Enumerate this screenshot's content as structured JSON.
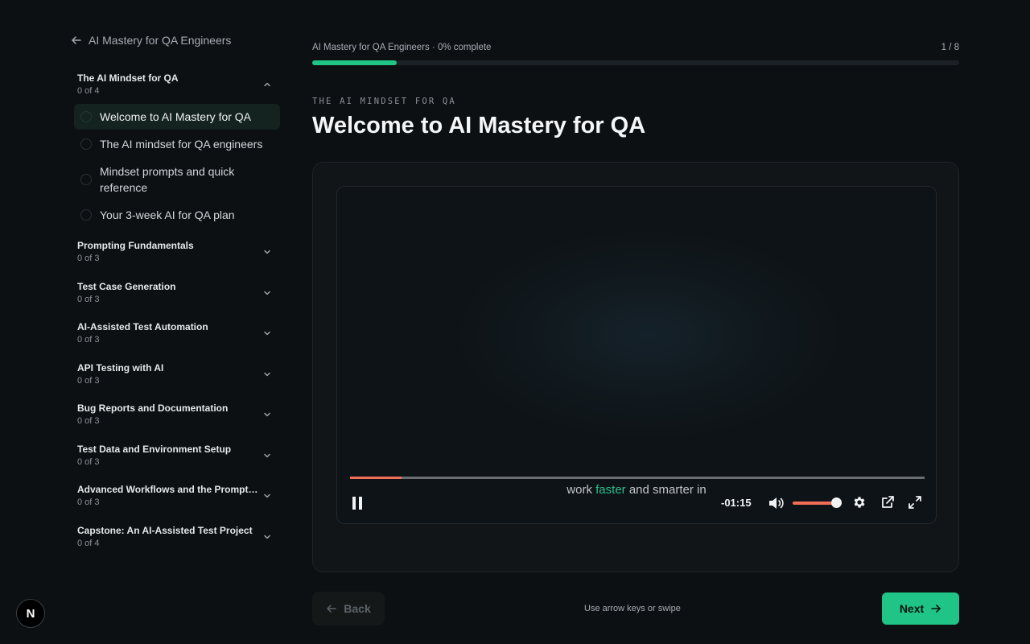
{
  "sidebar": {
    "back_label": "AI Mastery for QA Engineers",
    "sections": [
      {
        "title": "The AI Mindset for QA",
        "count": "0 of 4",
        "expanded": true
      },
      {
        "title": "Prompting Fundamentals",
        "count": "0 of 3",
        "expanded": false
      },
      {
        "title": "Test Case Generation",
        "count": "0 of 3",
        "expanded": false
      },
      {
        "title": "AI-Assisted Test Automation",
        "count": "0 of 3",
        "expanded": false
      },
      {
        "title": "API Testing with AI",
        "count": "0 of 3",
        "expanded": false
      },
      {
        "title": "Bug Reports and Documentation",
        "count": "0 of 3",
        "expanded": false
      },
      {
        "title": "Test Data and Environment Setup",
        "count": "0 of 3",
        "expanded": false
      },
      {
        "title": "Advanced Workflows and the Prompt…",
        "count": "0 of 3",
        "expanded": false
      },
      {
        "title": "Capstone: An AI-Assisted Test Project",
        "count": "0 of 4",
        "expanded": false
      }
    ],
    "lessons": [
      {
        "label": "Welcome to AI Mastery for QA",
        "active": true
      },
      {
        "label": "The AI mindset for QA engineers",
        "active": false
      },
      {
        "label": "Mindset prompts and quick reference",
        "active": false
      },
      {
        "label": "Your 3-week AI for QA plan",
        "active": false
      }
    ]
  },
  "header": {
    "progress_label": "AI Mastery for QA Engineers · 0% complete",
    "progress_count": "1 / 8",
    "progress_fraction": 0.13
  },
  "lesson": {
    "eyebrow": "THE AI MINDSET FOR QA",
    "title": "Welcome to AI Mastery for QA"
  },
  "player": {
    "caption_before": "work ",
    "caption_highlight": "faster",
    "caption_after": " and smarter in",
    "time_remaining": "-01:15",
    "playback_fraction": 0.09,
    "volume_fraction": 1.0,
    "icons": {
      "play_pause": "pause-icon",
      "volume": "volume-icon",
      "settings": "gear-icon",
      "popout": "external-link-icon",
      "fullscreen": "fullscreen-icon"
    }
  },
  "footer": {
    "back_label": "Back",
    "hint": "Use arrow keys or swipe",
    "next_label": "Next"
  },
  "badge": {
    "letter": "N"
  },
  "colors": {
    "accent": "#1fc486",
    "seek": "#f26d57",
    "background": "#0d1013"
  }
}
